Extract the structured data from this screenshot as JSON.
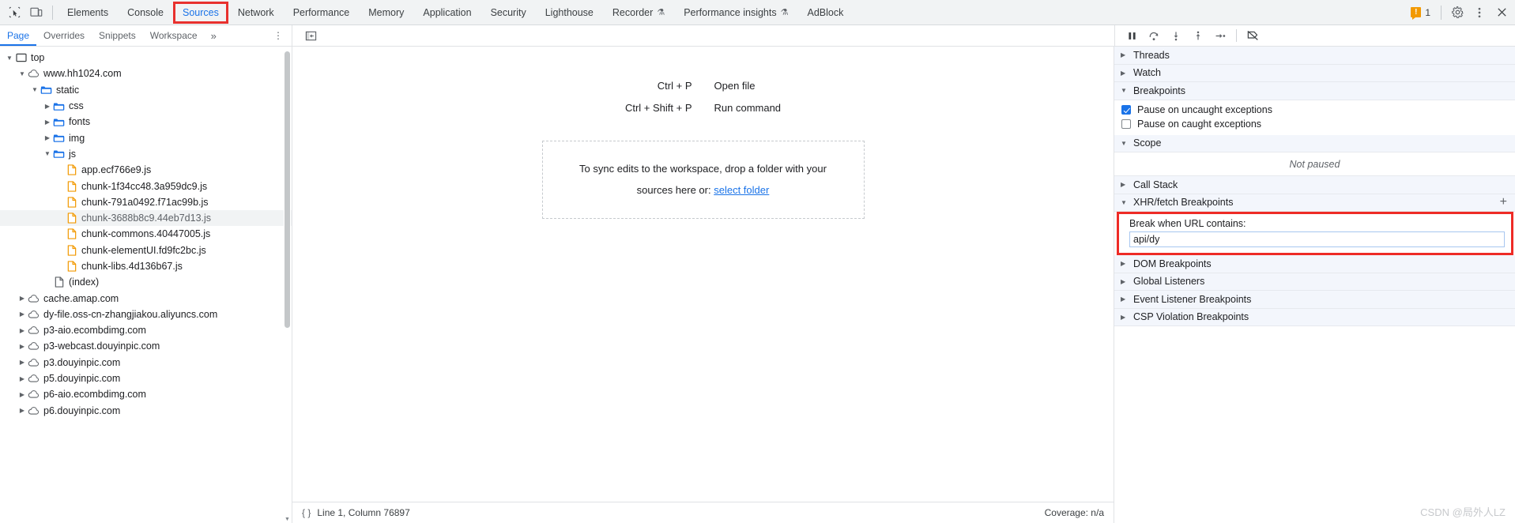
{
  "toolbar": {
    "inspect_icon": "inspect-element-icon",
    "device_icon": "device-toolbar-icon",
    "tabs": [
      {
        "label": "Elements",
        "flask": false,
        "active": false,
        "highlighted": false
      },
      {
        "label": "Console",
        "flask": false,
        "active": false,
        "highlighted": false
      },
      {
        "label": "Sources",
        "flask": false,
        "active": true,
        "highlighted": true
      },
      {
        "label": "Network",
        "flask": false,
        "active": false,
        "highlighted": false
      },
      {
        "label": "Performance",
        "flask": false,
        "active": false,
        "highlighted": false
      },
      {
        "label": "Memory",
        "flask": false,
        "active": false,
        "highlighted": false
      },
      {
        "label": "Application",
        "flask": false,
        "active": false,
        "highlighted": false
      },
      {
        "label": "Security",
        "flask": false,
        "active": false,
        "highlighted": false
      },
      {
        "label": "Lighthouse",
        "flask": false,
        "active": false,
        "highlighted": false
      },
      {
        "label": "Recorder",
        "flask": true,
        "active": false,
        "highlighted": false
      },
      {
        "label": "Performance insights",
        "flask": true,
        "active": false,
        "highlighted": false
      },
      {
        "label": "AdBlock",
        "flask": false,
        "active": false,
        "highlighted": false
      }
    ],
    "warning_count": "1",
    "warning_icon": "warning-icon",
    "settings_icon": "gear-icon",
    "more_icon": "kebab-menu-icon",
    "close_icon": "close-icon"
  },
  "navigator": {
    "tabs": [
      {
        "label": "Page",
        "active": true
      },
      {
        "label": "Overrides",
        "active": false
      },
      {
        "label": "Snippets",
        "active": false
      },
      {
        "label": "Workspace",
        "active": false
      }
    ],
    "more_tabs": "»",
    "kebab": "⋮",
    "tree": [
      {
        "label": "top",
        "indent": 0,
        "icon": "frame-icon",
        "arrow": "down",
        "selected": false
      },
      {
        "label": "www.hh1024.com",
        "indent": 1,
        "icon": "cloud-icon",
        "arrow": "down",
        "selected": false
      },
      {
        "label": "static",
        "indent": 2,
        "icon": "folder-icon",
        "arrow": "down",
        "selected": false
      },
      {
        "label": "css",
        "indent": 3,
        "icon": "folder-icon",
        "arrow": "right",
        "selected": false
      },
      {
        "label": "fonts",
        "indent": 3,
        "icon": "folder-icon",
        "arrow": "right",
        "selected": false
      },
      {
        "label": "img",
        "indent": 3,
        "icon": "folder-icon",
        "arrow": "right",
        "selected": false
      },
      {
        "label": "js",
        "indent": 3,
        "icon": "folder-icon",
        "arrow": "down",
        "selected": false
      },
      {
        "label": "app.ecf766e9.js",
        "indent": 4,
        "icon": "js-file-icon",
        "arrow": "none",
        "selected": false
      },
      {
        "label": "chunk-1f34cc48.3a959dc9.js",
        "indent": 4,
        "icon": "js-file-icon",
        "arrow": "none",
        "selected": false
      },
      {
        "label": "chunk-791a0492.f71ac99b.js",
        "indent": 4,
        "icon": "js-file-icon",
        "arrow": "none",
        "selected": false
      },
      {
        "label": "chunk-3688b8c9.44eb7d13.js",
        "indent": 4,
        "icon": "js-file-icon",
        "arrow": "none",
        "selected": true
      },
      {
        "label": "chunk-commons.40447005.js",
        "indent": 4,
        "icon": "js-file-icon",
        "arrow": "none",
        "selected": false
      },
      {
        "label": "chunk-elementUI.fd9fc2bc.js",
        "indent": 4,
        "icon": "js-file-icon",
        "arrow": "none",
        "selected": false
      },
      {
        "label": "chunk-libs.4d136b67.js",
        "indent": 4,
        "icon": "js-file-icon",
        "arrow": "none",
        "selected": false
      },
      {
        "label": "(index)",
        "indent": 3,
        "icon": "doc-file-icon",
        "arrow": "none",
        "selected": false
      },
      {
        "label": "cache.amap.com",
        "indent": 1,
        "icon": "cloud-icon",
        "arrow": "right",
        "selected": false
      },
      {
        "label": "dy-file.oss-cn-zhangjiakou.aliyuncs.com",
        "indent": 1,
        "icon": "cloud-icon",
        "arrow": "right",
        "selected": false
      },
      {
        "label": "p3-aio.ecombdimg.com",
        "indent": 1,
        "icon": "cloud-icon",
        "arrow": "right",
        "selected": false
      },
      {
        "label": "p3-webcast.douyinpic.com",
        "indent": 1,
        "icon": "cloud-icon",
        "arrow": "right",
        "selected": false
      },
      {
        "label": "p3.douyinpic.com",
        "indent": 1,
        "icon": "cloud-icon",
        "arrow": "right",
        "selected": false
      },
      {
        "label": "p5.douyinpic.com",
        "indent": 1,
        "icon": "cloud-icon",
        "arrow": "right",
        "selected": false
      },
      {
        "label": "p6-aio.ecombdimg.com",
        "indent": 1,
        "icon": "cloud-icon",
        "arrow": "right",
        "selected": false
      },
      {
        "label": "p6.douyinpic.com",
        "indent": 1,
        "icon": "cloud-icon",
        "arrow": "right",
        "selected": false
      }
    ]
  },
  "editor": {
    "show_navigator_icon": "show-navigator-icon",
    "shortcuts": [
      {
        "keys": "Ctrl + P",
        "desc": "Open file"
      },
      {
        "keys": "Ctrl + Shift + P",
        "desc": "Run command"
      }
    ],
    "dropzone_line1": "To sync edits to the workspace, drop a folder with your",
    "dropzone_line2_prefix": "sources here or:",
    "dropzone_link": "select folder"
  },
  "statusbar": {
    "braces": "{ }",
    "position": "Line 1, Column 76897",
    "coverage": "Coverage: n/a"
  },
  "debugger": {
    "controls": [
      {
        "icon": "pause-icon",
        "name": "pause-script-execution-button"
      },
      {
        "icon": "step-over-icon",
        "name": "step-over-button"
      },
      {
        "icon": "step-into-icon",
        "name": "step-into-button"
      },
      {
        "icon": "step-out-icon",
        "name": "step-out-button"
      },
      {
        "icon": "step-icon",
        "name": "step-button"
      },
      {
        "icon": "deactivate-breakpoints-icon",
        "name": "deactivate-breakpoints-button"
      }
    ],
    "sections": {
      "threads": "Threads",
      "watch": "Watch",
      "breakpoints": "Breakpoints",
      "scope": "Scope",
      "not_paused": "Not paused",
      "call_stack": "Call Stack",
      "xhr_fetch": "XHR/fetch Breakpoints",
      "dom_breakpoints": "DOM Breakpoints",
      "global_listeners": "Global Listeners",
      "event_listener_breakpoints": "Event Listener Breakpoints",
      "csp_violation_breakpoints": "CSP Violation Breakpoints"
    },
    "pause_uncaught": {
      "label": "Pause on uncaught exceptions",
      "checked": true
    },
    "pause_caught": {
      "label": "Pause on caught exceptions",
      "checked": false
    },
    "xhr": {
      "label": "Break when URL contains:",
      "value": "api/dy",
      "add_icon": "plus-icon"
    }
  },
  "watermark": "CSDN @局外人LZ"
}
